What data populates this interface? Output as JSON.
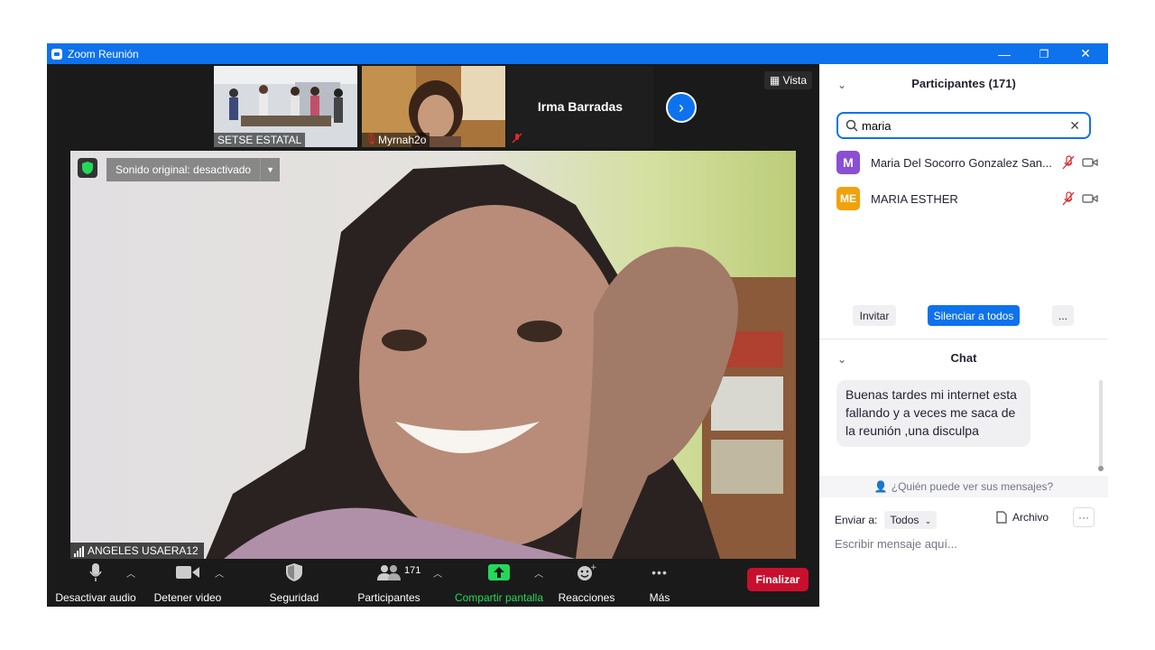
{
  "window": {
    "title": "Zoom Reunión",
    "minimize": "—",
    "restore": "❐",
    "close": "✕"
  },
  "thumbnails": [
    {
      "name": "SETSE ESTATAL"
    },
    {
      "name": "Myrnah2o"
    },
    {
      "name": "Irma Barradas"
    }
  ],
  "vista_label": "Vista",
  "main_video": {
    "sound_label": "Sonido original: desactivado",
    "participant_name": "ANGELES USAERA12"
  },
  "toolbar": {
    "audio": "Desactivar audio",
    "video": "Detener video",
    "security": "Seguridad",
    "participants": "Participantes",
    "participants_count": "171",
    "share": "Compartir pantalla",
    "reactions": "Reacciones",
    "more": "Más",
    "end": "Finalizar"
  },
  "participants_panel": {
    "title": "Participantes (171)",
    "search_value": "maria",
    "items": [
      {
        "initials": "M",
        "name": "Maria Del Socorro Gonzalez San...",
        "color": "#8a4fd3"
      },
      {
        "initials": "ME",
        "name": "MARIA ESTHER",
        "color": "#f0a20b"
      }
    ],
    "invite": "Invitar",
    "mute_all": "Silenciar a todos",
    "more": "..."
  },
  "chat": {
    "title": "Chat",
    "message": "Buenas tardes mi internet esta fallando y a veces me saca de la reunión ,una disculpa",
    "who_can_see": "¿Quién puede ver sus mensajes?",
    "send_to_label": "Enviar a:",
    "send_to_value": "Todos",
    "file_label": "Archivo",
    "more": "···",
    "input_placeholder": "Escribir mensaje aquí..."
  },
  "colors": {
    "accent": "#0e72ed",
    "end_red": "#c8102e",
    "share_green": "#23d959",
    "mute_red": "#e02828"
  }
}
